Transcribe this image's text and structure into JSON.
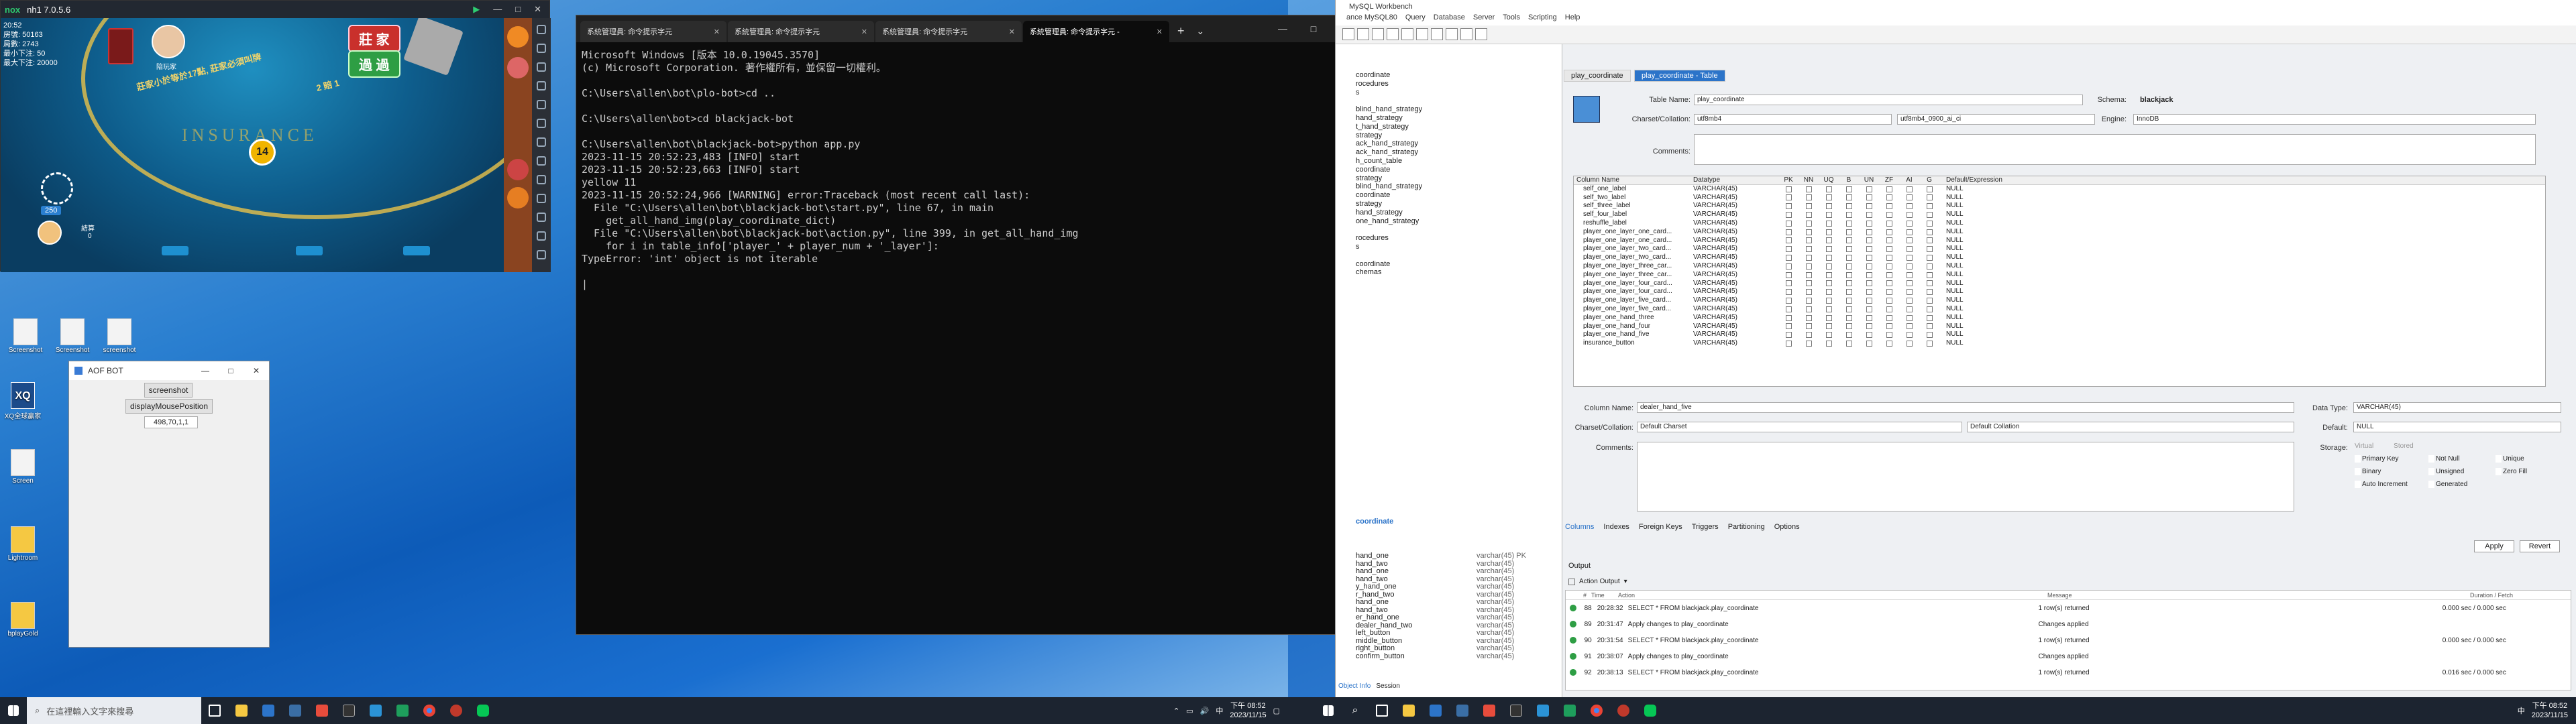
{
  "emulator": {
    "title": "nh1 7.0.5.6",
    "brand": "nox",
    "time": "20:52",
    "stats": [
      "房號: 50163",
      "局數: 2743",
      "最小下注: 50",
      "最大下注: 20000"
    ],
    "player_name": "陪玩家",
    "banker_label": "莊 家",
    "pass_label": "過 過",
    "rule_text": "莊家小於等於17點, 莊家必須叫牌",
    "insurance_text": "INSURANCE",
    "pays_text": "2 賠 1",
    "count_badge": "14",
    "bet_chip": "250",
    "balance_label": "結算",
    "balance_value": "0",
    "window_controls": [
      "—",
      "□",
      "✕"
    ]
  },
  "desktop_icons": [
    {
      "label": "Screenshot"
    },
    {
      "label": "Screenshot"
    },
    {
      "label": "screenshot"
    },
    {
      "label": "XQ全球贏家"
    },
    {
      "label": "Screen"
    },
    {
      "label": "Lightroom"
    },
    {
      "label": "bplayGold"
    }
  ],
  "cmd": {
    "tabs": [
      {
        "label": "系統管理員: 命令提示字元"
      },
      {
        "label": "系統管理員: 命令提示字元"
      },
      {
        "label": "系統管理員: 命令提示字元"
      },
      {
        "label": "系統管理員: 命令提示字元 -"
      }
    ],
    "new_tab": "+",
    "dropdown": "⌄",
    "lines": [
      "Microsoft Windows [版本 10.0.19045.3570]",
      "(c) Microsoft Corporation. 著作權所有，並保留一切權利。",
      "",
      "C:\\Users\\allen\\bot\\plo-bot>cd ..",
      "",
      "C:\\Users\\allen\\bot>cd blackjack-bot",
      "",
      "C:\\Users\\allen\\bot\\blackjack-bot>python app.py",
      "2023-11-15 20:52:23,483 [INFO] start",
      "2023-11-15 20:52:23,663 [INFO] start",
      "yellow 11",
      "2023-11-15 20:52:24,966 [WARNING] error:Traceback (most recent call last):",
      "  File \"C:\\Users\\allen\\bot\\blackjack-bot\\start.py\", line 67, in main",
      "    get_all_hand_img(play_coordinate_dict)",
      "  File \"C:\\Users\\allen\\bot\\blackjack-bot\\action.py\", line 399, in get_all_hand_img",
      "    for i in table_info['player_' + player_num + '_layer']:",
      "TypeError: 'int' object is not iterable",
      "",
      "|"
    ]
  },
  "bot": {
    "title": "AOF BOT",
    "screenshot_label": "screenshot",
    "display_pos_label": "displayMousePosition",
    "coords": "498,70,1,1"
  },
  "workbench": {
    "title": "MySQL Workbench",
    "conn_tab": "ance MySQL80",
    "menu": [
      "Query",
      "Database",
      "Server",
      "Tools",
      "Scripting",
      "Help"
    ],
    "tabs": [
      "play_coordinate",
      "play_coordinate - Table"
    ],
    "nav_items": [
      "coordinate",
      "rocedures",
      "s",
      "",
      "blind_hand_strategy",
      "hand_strategy",
      "t_hand_strategy",
      "strategy",
      "ack_hand_strategy",
      "ack_hand_strategy",
      "h_count_table",
      "coordinate",
      "strategy",
      "blind_hand_strategy",
      "coordinate",
      "strategy",
      "hand_strategy",
      "one_hand_strategy",
      "",
      "rocedures",
      "s",
      "",
      "coordinate",
      "chemas"
    ],
    "nav_detail_title": "coordinate",
    "nav_detail_rows": [
      {
        "name": "hand_one",
        "type": "varchar(45) PK"
      },
      {
        "name": "hand_two",
        "type": "varchar(45)"
      },
      {
        "name": "hand_one",
        "type": "varchar(45)"
      },
      {
        "name": "hand_two",
        "type": "varchar(45)"
      },
      {
        "name": "y_hand_one",
        "type": "varchar(45)"
      },
      {
        "name": "r_hand_two",
        "type": "varchar(45)"
      },
      {
        "name": "hand_one",
        "type": "varchar(45)"
      },
      {
        "name": "hand_two",
        "type": "varchar(45)"
      },
      {
        "name": "er_hand_one",
        "type": "varchar(45)"
      },
      {
        "name": "dealer_hand_two",
        "type": "varchar(45)"
      },
      {
        "name": "left_button",
        "type": "varchar(45)"
      },
      {
        "name": "middle_button",
        "type": "varchar(45)"
      },
      {
        "name": "right_button",
        "type": "varchar(45)"
      },
      {
        "name": "confirm_button",
        "type": "varchar(45)"
      }
    ],
    "nav_footer": [
      "Object Info",
      "Session"
    ],
    "table_name_label": "Table Name:",
    "table_name": "play_coordinate",
    "schema_label": "Schema:",
    "schema": "blackjack",
    "charset_label": "Charset/Collation:",
    "charset": "utf8mb4",
    "collation": "utf8mb4_0900_ai_ci",
    "engine_label": "Engine:",
    "engine": "InnoDB",
    "comments_label": "Comments:",
    "col_headers": [
      "Column Name",
      "Datatype",
      "PK",
      "NN",
      "UQ",
      "B",
      "UN",
      "ZF",
      "AI",
      "G",
      "Default/Expression"
    ],
    "columns": [
      {
        "name": "self_one_label",
        "type": "VARCHAR(45)",
        "def": "NULL"
      },
      {
        "name": "self_two_label",
        "type": "VARCHAR(45)",
        "def": "NULL"
      },
      {
        "name": "self_three_label",
        "type": "VARCHAR(45)",
        "def": "NULL"
      },
      {
        "name": "self_four_label",
        "type": "VARCHAR(45)",
        "def": "NULL"
      },
      {
        "name": "reshuffle_label",
        "type": "VARCHAR(45)",
        "def": "NULL"
      },
      {
        "name": "player_one_layer_one_card...",
        "type": "VARCHAR(45)",
        "def": "NULL"
      },
      {
        "name": "player_one_layer_one_card...",
        "type": "VARCHAR(45)",
        "def": "NULL"
      },
      {
        "name": "player_one_layer_two_card...",
        "type": "VARCHAR(45)",
        "def": "NULL"
      },
      {
        "name": "player_one_layer_two_card...",
        "type": "VARCHAR(45)",
        "def": "NULL"
      },
      {
        "name": "player_one_layer_three_car...",
        "type": "VARCHAR(45)",
        "def": "NULL"
      },
      {
        "name": "player_one_layer_three_car...",
        "type": "VARCHAR(45)",
        "def": "NULL"
      },
      {
        "name": "player_one_layer_four_card...",
        "type": "VARCHAR(45)",
        "def": "NULL"
      },
      {
        "name": "player_one_layer_four_card...",
        "type": "VARCHAR(45)",
        "def": "NULL"
      },
      {
        "name": "player_one_layer_five_card...",
        "type": "VARCHAR(45)",
        "def": "NULL"
      },
      {
        "name": "player_one_layer_five_card...",
        "type": "VARCHAR(45)",
        "def": "NULL"
      },
      {
        "name": "player_one_hand_three",
        "type": "VARCHAR(45)",
        "def": "NULL"
      },
      {
        "name": "player_one_hand_four",
        "type": "VARCHAR(45)",
        "def": "NULL"
      },
      {
        "name": "player_one_hand_five",
        "type": "VARCHAR(45)",
        "def": "NULL"
      },
      {
        "name": "insurance_button",
        "type": "VARCHAR(45)",
        "def": "NULL"
      }
    ],
    "col_name_label": "Column Name:",
    "col_name": "dealer_hand_five",
    "datatype_label": "Data Type:",
    "datatype": "VARCHAR(45)",
    "col_charset_label": "Charset/Collation:",
    "col_charset": "Default Charset",
    "col_collation": "Default Collation",
    "default_label": "Default:",
    "default_value": "NULL",
    "col_comments_label": "Comments:",
    "storage_label": "Storage:",
    "storage_opts": [
      "Virtual",
      "Stored"
    ],
    "flags": [
      "Primary Key",
      "Not Null",
      "Unique",
      "Binary",
      "Unsigned",
      "Zero Fill",
      "Auto Increment",
      "Generated"
    ],
    "bottom_tabs": [
      "Columns",
      "Indexes",
      "Foreign Keys",
      "Triggers",
      "Partitioning",
      "Options"
    ],
    "apply": "Apply",
    "revert": "Revert",
    "output_label": "Output",
    "action_output": "Action Output",
    "out_headers": [
      "#",
      "Time",
      "Action",
      "Message",
      "Duration / Fetch"
    ],
    "out_rows": [
      {
        "n": "88",
        "t": "20:28:32",
        "a": "SELECT * FROM blackjack.play_coordinate",
        "m": "1 row(s) returned",
        "d": "0.000 sec / 0.000 sec"
      },
      {
        "n": "89",
        "t": "20:31:47",
        "a": "Apply changes to play_coordinate",
        "m": "Changes applied",
        "d": ""
      },
      {
        "n": "90",
        "t": "20:31:54",
        "a": "SELECT * FROM blackjack.play_coordinate",
        "m": "1 row(s) returned",
        "d": "0.000 sec / 0.000 sec"
      },
      {
        "n": "91",
        "t": "20:38:07",
        "a": "Apply changes to play_coordinate",
        "m": "Changes applied",
        "d": ""
      },
      {
        "n": "92",
        "t": "20:38:13",
        "a": "SELECT * FROM blackjack.play_coordinate",
        "m": "1 row(s) returned",
        "d": "0.016 sec / 0.000 sec"
      }
    ]
  },
  "taskbar_left": {
    "search_placeholder": "在這裡輸入文字來搜尋",
    "time": "下午 08:52",
    "date": "2023/11/15",
    "ime": "中"
  },
  "taskbar_right": {
    "time": "下午 08:52",
    "date": "2023/11/15",
    "ime": "中"
  }
}
